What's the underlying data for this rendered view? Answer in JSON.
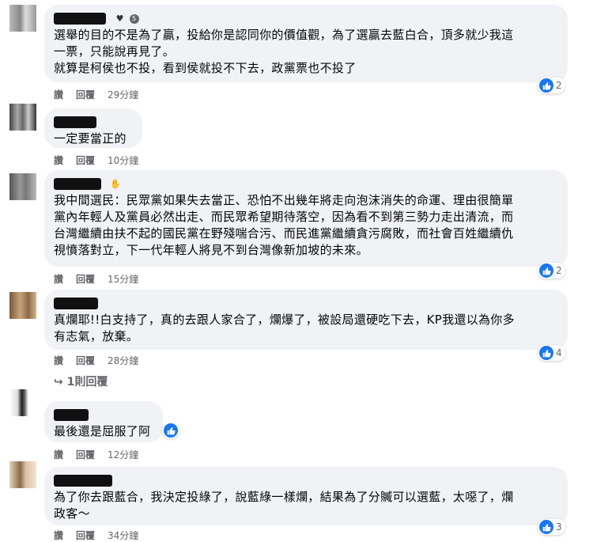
{
  "comments": [
    {
      "badge_count": "5",
      "text": "選舉的目的不是為了贏，投給你是認同你的價值觀，為了選贏去藍白合，頂多就少我這\n一票，只能說再見了。\n就算是柯侯也不投，看到侯就投不下去，政黨票也不投了",
      "actions": {
        "like": "讚",
        "reply": "回覆",
        "time": "29分鐘"
      },
      "reactions": "2"
    },
    {
      "text": "一定要當正的",
      "actions": {
        "like": "讚",
        "reply": "回覆",
        "time": "10分鐘"
      }
    },
    {
      "text": "我中間選民：民眾黨如果失去當正、恐怕不出幾年將走向泡沫消失的命運、理由很簡單\n黨內年輕人及黨員必然出走、而民眾希望期待落空，因為看不到第三勢力走出清流，而\n台灣繼續由扶不起的國民黨在野殘喘合污、而民進黨繼續貪污腐敗，而社會百姓繼續仇\n視憤落對立，下一代年輕人將見不到台灣像新加坡的未來。",
      "actions": {
        "like": "讚",
        "reply": "回覆",
        "time": "15分鐘"
      },
      "reactions": "2"
    },
    {
      "text": "真爛耶!!白支持了，真的去跟人家合了，爛爆了，被設局還硬吃下去，KP我還以為你多\n有志氣，放棄。",
      "actions": {
        "like": "讚",
        "reply": "回覆",
        "time": "28分鐘"
      },
      "reactions": "4",
      "replies": "1則回覆"
    },
    {
      "text": "最後還是屈服了阿",
      "actions": {
        "like": "讚",
        "reply": "回覆",
        "time": "12分鐘"
      }
    },
    {
      "text": "為了你去跟藍合，我決定投綠了，說藍綠一樣爛，結果為了分贓可以選藍，太噁了，爛\n政客～",
      "actions": {
        "like": "讚",
        "reply": "回覆",
        "time": "34分鐘"
      },
      "reactions": "3"
    }
  ],
  "colors": {
    "bubble": "#f0f2f5",
    "like": "#1877f2",
    "meta": "#65676b"
  },
  "icons": {
    "like": "thumbs-up-icon",
    "reply_arrow": "reply-arrow-icon",
    "badge": "heart-badge-icon"
  }
}
